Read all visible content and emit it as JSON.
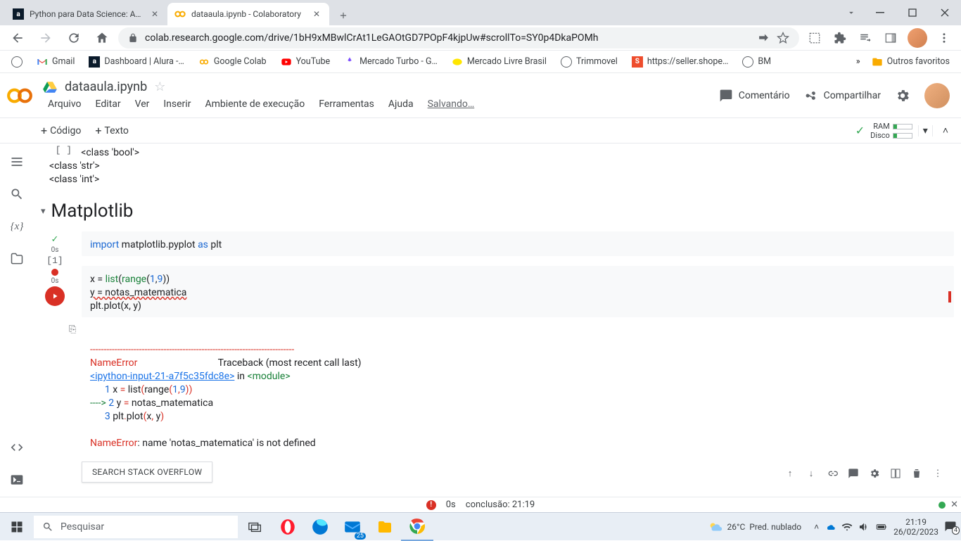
{
  "tabs": [
    {
      "title": "Python para Data Science: Aula 5",
      "favicon": "alura"
    },
    {
      "title": "dataaula.ipynb - Colaboratory",
      "favicon": "colab",
      "active": true
    }
  ],
  "url": "colab.research.google.com/drive/1bH9xMBwlCrAt1LeGAOtGD7POpF4kjpUw#scrollTo=SY0p4DkaPOMh",
  "bookmarks": [
    {
      "label": "Gmail",
      "icon": "gmail"
    },
    {
      "label": "Dashboard | Alura -…",
      "icon": "alura"
    },
    {
      "label": "Google Colab",
      "icon": "colab"
    },
    {
      "label": "YouTube",
      "icon": "youtube"
    },
    {
      "label": "Mercado Turbo - G…",
      "icon": "mt"
    },
    {
      "label": "Mercado Livre Brasil",
      "icon": "ml"
    },
    {
      "label": "Trimmovel",
      "icon": "globe"
    },
    {
      "label": "https://seller.shope…",
      "icon": "shopee"
    },
    {
      "label": "BM",
      "icon": "globe"
    }
  ],
  "bookmarks_overflow": "»",
  "bookmarks_other": "Outros favoritos",
  "doc": {
    "title": "dataaula.ipynb"
  },
  "menu": [
    "Arquivo",
    "Editar",
    "Ver",
    "Inserir",
    "Ambiente de execução",
    "Ferramentas",
    "Ajuda"
  ],
  "saving": "Salvando…",
  "header_right": {
    "comment": "Comentário",
    "share": "Compartilhar"
  },
  "toolbar": {
    "code": "Código",
    "text": "Texto",
    "ram": "RAM",
    "disk": "Disco"
  },
  "output0": [
    "<class 'bool'>",
    "<class 'str'>",
    "<class 'int'>"
  ],
  "out0_gutter": "[ ]",
  "section": "Matplotlib",
  "cell1": {
    "num": "[1]",
    "time": "0s"
  },
  "cell2": {
    "time": "0s"
  },
  "code1_parts": {
    "import": "import",
    "mod": " matplotlib.pyplot ",
    "as": "as",
    "alias": " plt"
  },
  "code2_lines": {
    "l1a": "x = ",
    "l1b": "list",
    "l1c": "(",
    "l1d": "range",
    "l1e": "(",
    "l1f": "1",
    "l1g": ",",
    "l1h": "9",
    "l1i": "))",
    "l2": "y = notas_matematica",
    "l3a": "plt.plot(x, y)"
  },
  "traceback": {
    "dash": "---------------------------------------------------------------------------",
    "err": "NameError",
    "header_rest": "                                 Traceback (most recent call last)",
    "link": "<ipython-input-21-a7f5c35fdc8e>",
    "in": " in ",
    "module": "<module>",
    "l1": "      1 x = list(range(1,9))",
    "l1_a": "      ",
    "l1_b": "1",
    "l1_c": " x ",
    "l1_d": "=",
    "l1_e": " list",
    "l1_f": "(",
    "l1_g": "range",
    "l1_h": "(",
    "l1_i": "1",
    "l1_j": ",",
    "l1_k": "9",
    "l1_l": "))",
    "l2_a": "----> ",
    "l2_b": "2",
    "l2_c": " y ",
    "l2_d": "=",
    "l2_e": " notas_matematica",
    "l3_a": "      ",
    "l3_b": "3",
    "l3_c": " plt",
    "l3_d": ".",
    "l3_e": "plot",
    "l3_f": "(",
    "l3_g": "x",
    "l3_h": ",",
    "l3_i": " y",
    "l3_j": ")",
    "blank": "",
    "final_a": "NameError",
    "final_b": ": name 'notas_matematica' is not defined"
  },
  "search_so": "SEARCH STACK OVERFLOW",
  "status": {
    "time": "0s",
    "done": "conclusão: 21:19"
  },
  "taskbar": {
    "search": "Pesquisar",
    "weather_temp": "26°C",
    "weather_desc": "Pred. nublado",
    "time": "21:19",
    "date": "26/02/2023",
    "badge_mail": "25",
    "badge_notif": "4"
  }
}
